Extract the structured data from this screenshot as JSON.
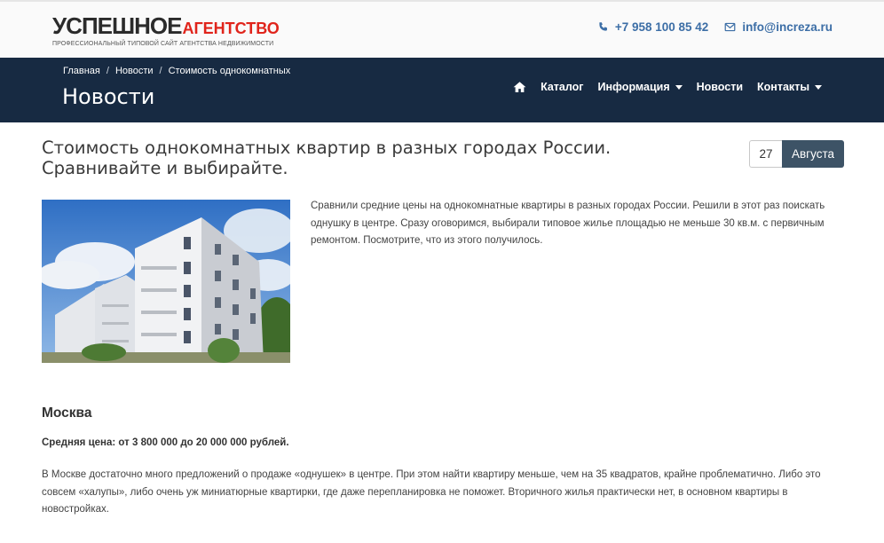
{
  "header": {
    "logo_main": "УСПЕШНОЕ",
    "logo_accent": "АГЕНТСТВО",
    "logo_tagline": "ПРОФЕССИОНАЛЬНЫЙ ТИПОВОЙ САЙТ АГЕНТСТВА НЕДВИЖИМОСТИ",
    "phone": "+7 958 100 85 42",
    "email": "info@increza.ru",
    "accent_color": "#e0241b",
    "link_color": "#3c6ea6"
  },
  "navband": {
    "background": "#172a42",
    "breadcrumb": [
      "Главная",
      "Новости",
      "Стоимость однокомнатных"
    ],
    "breadcrumb_separator": "/",
    "page_title": "Новости",
    "menu": [
      {
        "label": "Каталог"
      },
      {
        "label": "Информация"
      },
      {
        "label": "Новости"
      },
      {
        "label": "Контакты"
      }
    ]
  },
  "article": {
    "title": "Стоимость однокомнатных квартир в разных городах России. Сравнивайте и выбирайте.",
    "date_day": "27",
    "date_month": "Августа",
    "intro": "Сравнили средние цены на однокомнатные квартиры в разных городах России. Решили в этот раз поискать однушку в центре. Сразу оговоримся, выбирали типовое жилье площадью не меньше 30 кв.м. с первичным ремонтом. Посмотрите, что из этого получилось.",
    "section": {
      "city": "Москва",
      "price": "Средняя цена: от 3 800 000 до 20 000 000 рублей.",
      "text": "В Москве достаточно много предложений о продаже «однушек» в центре. При этом найти квартиру меньше, чем на 35 квадратов, крайне проблематично. Либо это совсем «халупы», либо очень уж миниатюрные квартирки, где даже перепланировка не поможет. Вторичного жилья практически нет, в основном квартиры в новостройках."
    }
  }
}
